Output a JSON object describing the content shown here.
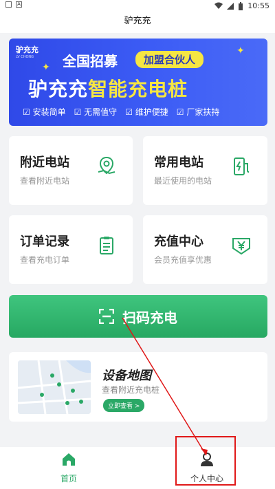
{
  "status_bar": {
    "time": "10:55"
  },
  "app_title": "驴充充",
  "banner": {
    "logo": "驴充充",
    "logo_sub": "LV CHONG",
    "recruit": "全国招募",
    "join_badge": "加盟合伙人",
    "headline_brand": "驴充充",
    "headline_rest": "智能充电桩",
    "features": [
      "安装简单",
      "无需值守",
      "维护便捷",
      "厂家扶持"
    ]
  },
  "cards": [
    {
      "title": "附近电站",
      "subtitle": "查看附近电站",
      "icon": "map-pin-icon"
    },
    {
      "title": "常用电站",
      "subtitle": "最近使用的电站",
      "icon": "charging-station-icon"
    },
    {
      "title": "订单记录",
      "subtitle": "查看充电订单",
      "icon": "clipboard-icon"
    },
    {
      "title": "充值中心",
      "subtitle": "会员充值享优惠",
      "icon": "yuan-icon"
    }
  ],
  "scan_button": "扫码充电",
  "map_card": {
    "title": "设备地图",
    "subtitle": "查看附近充电桩",
    "button": "立即查看 >"
  },
  "tabs": [
    {
      "label": "首页"
    },
    {
      "label": "个人中心"
    }
  ],
  "colors": {
    "accent": "#2aa866",
    "banner": "#3c5cf5",
    "highlight": "#f6e642",
    "annotation": "#e01818"
  }
}
